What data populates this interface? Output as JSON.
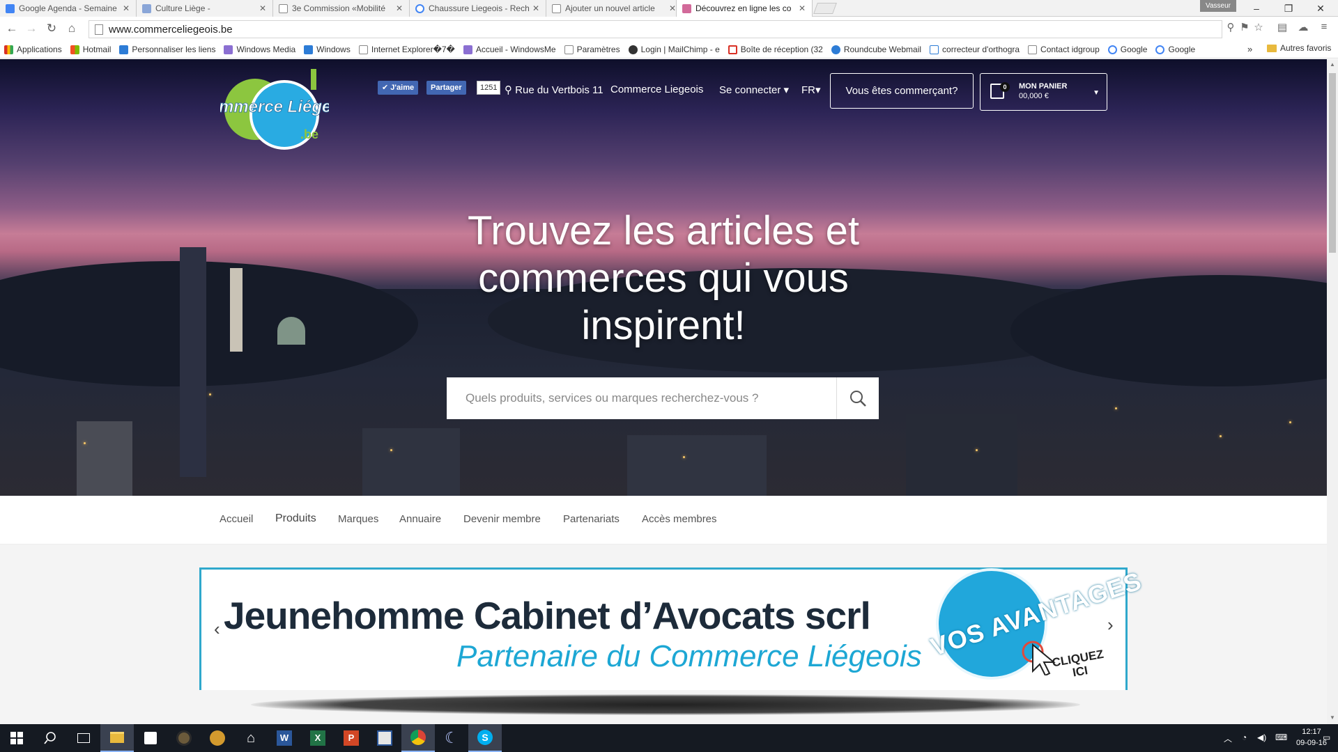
{
  "browser": {
    "tabs": [
      {
        "label": "Google Agenda - Semaine",
        "color": "#4285f4"
      },
      {
        "label": "Culture Liège -",
        "color": "#8aa6d8"
      },
      {
        "label": "3e Commission «Mobilité",
        "color": "#ffffff"
      },
      {
        "label": "Chaussure Liegeois - Rech",
        "color": "#ffffff"
      },
      {
        "label": "Ajouter un nouvel article",
        "color": "#ffffff"
      },
      {
        "label": "Découvrez en ligne les co",
        "color": "#d26a9a"
      }
    ],
    "profile": "Vasseur",
    "url": "www.commerceliegeois.be",
    "bookmarks": [
      {
        "label": "Applications",
        "color": "#d93025"
      },
      {
        "label": "Hotmail",
        "color": "#f25022"
      },
      {
        "label": "Personnaliser les liens",
        "color": "#2d7cd6"
      },
      {
        "label": "Windows Media",
        "color": "#8b6fd2"
      },
      {
        "label": "Windows",
        "color": "#2d7cd6"
      },
      {
        "label": "Internet Explorer�7�",
        "color": "#ffffff"
      },
      {
        "label": "Accueil - WindowsMe",
        "color": "#8b6fd2"
      },
      {
        "label": "Paramètres",
        "color": "#ffffff"
      },
      {
        "label": "Login | MailChimp - e",
        "color": "#333333"
      },
      {
        "label": "Boîte de réception (32",
        "color": "#d93025"
      },
      {
        "label": "Roundcube Webmail",
        "color": "#2d7cd6"
      },
      {
        "label": "correcteur d'orthogra",
        "color": "#2d7cd6"
      },
      {
        "label": "Contact idgroup",
        "color": "#ffffff"
      },
      {
        "label": "Google",
        "color": "#4285f4"
      },
      {
        "label": "Google",
        "color": "#4285f4"
      }
    ],
    "bookmarks_more": "»",
    "other_bookmarks": "Autres favoris"
  },
  "site": {
    "logo_text": "Commerce Liégeois",
    "logo_tld": ".be",
    "fb_like": "J'aime",
    "fb_share": "Partager",
    "fb_count": "1251",
    "address": "Rue du Vertbois 11",
    "brand": "Commerce Liegeois",
    "login": "Se connecter",
    "lang": "FR",
    "merchant_btn": "Vous êtes commerçant?",
    "cart": {
      "count": "0",
      "title": "MON PANIER",
      "total": "00,000 €"
    },
    "headline": "Trouvez les articles et commerces qui vous inspirent!",
    "search_placeholder": "Quels produits, services ou marques recherchez-vous ?",
    "menu": [
      "Accueil",
      "Produits",
      "Marques",
      "Annuaire",
      "Devenir membre",
      "Partenariats",
      "Accès membres"
    ],
    "banner": {
      "title": "Jeunehomme Cabinet d’Avocats scrl",
      "subtitle": "Partenaire du Commerce Liégeois",
      "badge": "VOS AVANTAGES",
      "cta_line1": "CLIQUEZ",
      "cta_line2": "ICI"
    }
  },
  "taskbar": {
    "time": "12:17",
    "date": "09-09-16",
    "apps": [
      "start",
      "search",
      "task-view",
      "file-explorer",
      "store",
      "media",
      "app",
      "home",
      "word",
      "excel",
      "powerpoint",
      "publisher",
      "chrome",
      "app2",
      "skype"
    ]
  }
}
